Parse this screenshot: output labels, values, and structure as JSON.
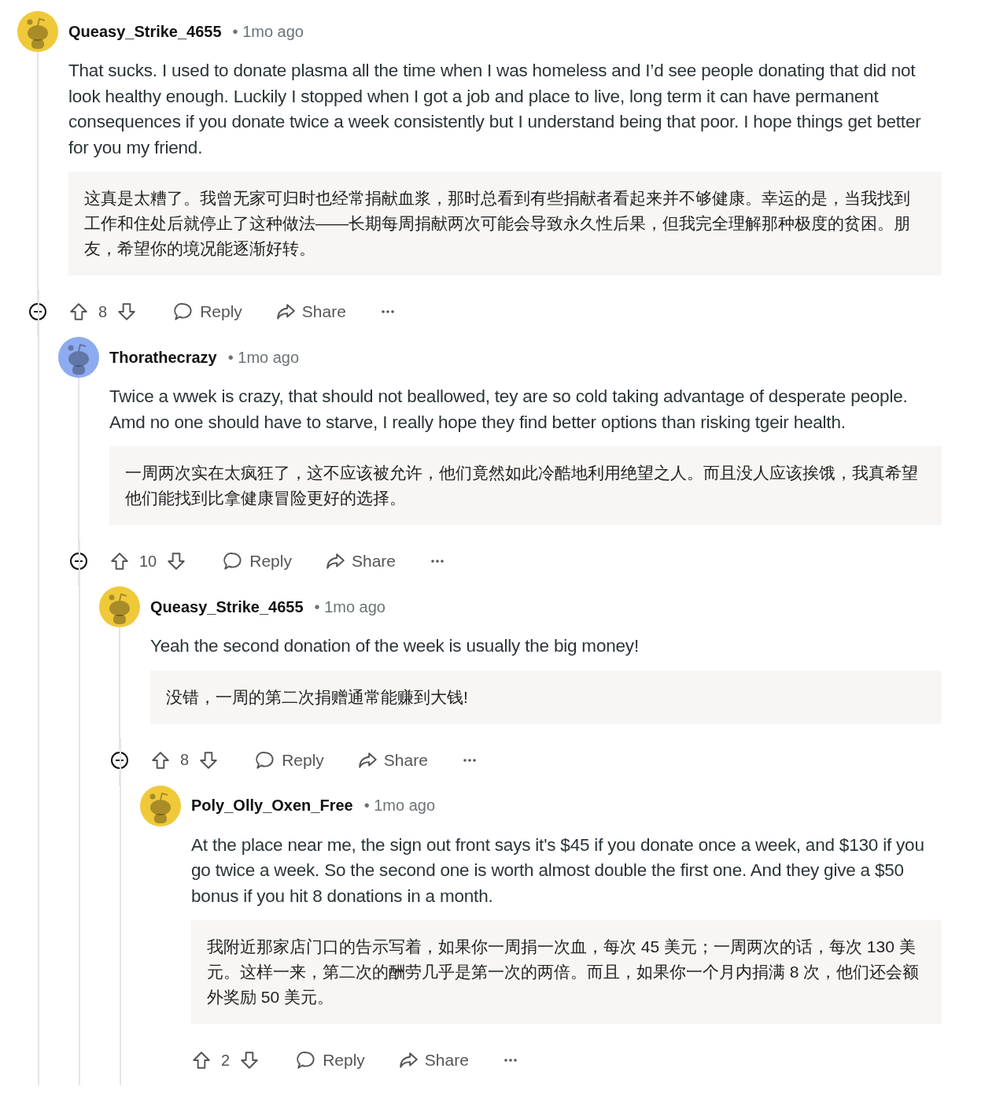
{
  "comments": [
    {
      "author": "Queasy_Strike_4655",
      "color": "#f0c93a",
      "time": "• 1mo ago",
      "body": "That sucks. I used to donate plasma all the time when I was homeless and I’d see people donating that did not look healthy enough. Luckily I stopped when I got a job and place to live, long term it can have permanent consequences if you donate twice a week consistently but I understand being that poor. I hope things get better for you my friend.",
      "translation": "这真是太糟了。我曾无家可归时也经常捐献血浆，那时总看到有些捐献者看起来并不够健康。幸运的是，当我找到工作和住处后就停止了这种做法——长期每周捐献两次可能会导致永久性后果，但我完全理解那种极度的贫困。朋友，希望你的境况能逐渐好转。",
      "votes": "8",
      "reply": "Reply",
      "share": "Share",
      "expanded": true,
      "children": [
        {
          "author": "Thorathecrazy",
          "color": "#8dabf0",
          "time": "• 1mo ago",
          "body": "Twice a wwek is crazy, that should not beallowed, tey are so cold taking advantage of desperate people. Amd no one should have to starve, I really hope they find better options than risking tgeir health.",
          "translation": "一周两次实在太疯狂了，这不应该被允许，他们竟然如此冷酷地利用绝望之人。而且没人应该挨饿，我真希望他们能找到比拿健康冒险更好的选择。",
          "votes": "10",
          "reply": "Reply",
          "share": "Share",
          "expanded": true,
          "children": [
            {
              "author": "Queasy_Strike_4655",
              "color": "#f0c93a",
              "time": "• 1mo ago",
              "body": "Yeah the second donation of the week is usually the big money!",
              "translation": "没错，一周的第二次捐赠通常能赚到大钱!",
              "votes": "8",
              "reply": "Reply",
              "share": "Share",
              "expanded": true,
              "children": [
                {
                  "author": "Poly_Olly_Oxen_Free",
                  "color": "#f0c93a",
                  "time": "• 1mo ago",
                  "body": "At the place near me, the sign out front says it's $45 if you donate once a week, and $130 if you go twice a week. So the second one is worth almost double the first one. And they give a $50 bonus if you hit 8 donations in a month.",
                  "translation": "我附近那家店门口的告示写着，如果你一周捐一次血，每次 45 美元；一周两次的话，每次 130 美元。这样一来，第二次的酬劳几乎是第一次的两倍。而且，如果你一个月内捐满 8 次，他们还会额外奖励 50 美元。",
                  "votes": "2",
                  "reply": "Reply",
                  "share": "Share"
                }
              ]
            }
          ]
        }
      ]
    }
  ]
}
